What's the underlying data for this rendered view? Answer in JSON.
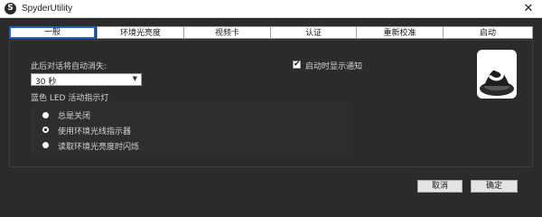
{
  "window": {
    "title": "SpyderUtility",
    "close_glyph": "✕"
  },
  "tabs": [
    {
      "label": "一般",
      "active": true
    },
    {
      "label": "环境光亮度",
      "active": false
    },
    {
      "label": "视频卡",
      "active": false
    },
    {
      "label": "认证",
      "active": false
    },
    {
      "label": "重新校准",
      "active": false
    },
    {
      "label": "启动",
      "active": false
    }
  ],
  "general": {
    "dismiss_label": "此后对话将自动消失:",
    "dismiss_value": "30 秒",
    "dropdown_icon": "chevron-down-icon",
    "startup_notify_label": "启动时显示通知",
    "startup_notify_checked": true,
    "led_group_label": "蓝色 LED 活动指示灯",
    "led_options": [
      {
        "label": "总是关闭",
        "selected": false
      },
      {
        "label": "使用环境光线指示器",
        "selected": true
      },
      {
        "label": "读取环境光亮度时闪烁",
        "selected": false
      }
    ]
  },
  "buttons": {
    "cancel": "取消",
    "ok": "确定"
  },
  "colors": {
    "background": "#2b2b2b",
    "active_tab_border": "#1e63c5",
    "text": "#d4d4d4"
  }
}
